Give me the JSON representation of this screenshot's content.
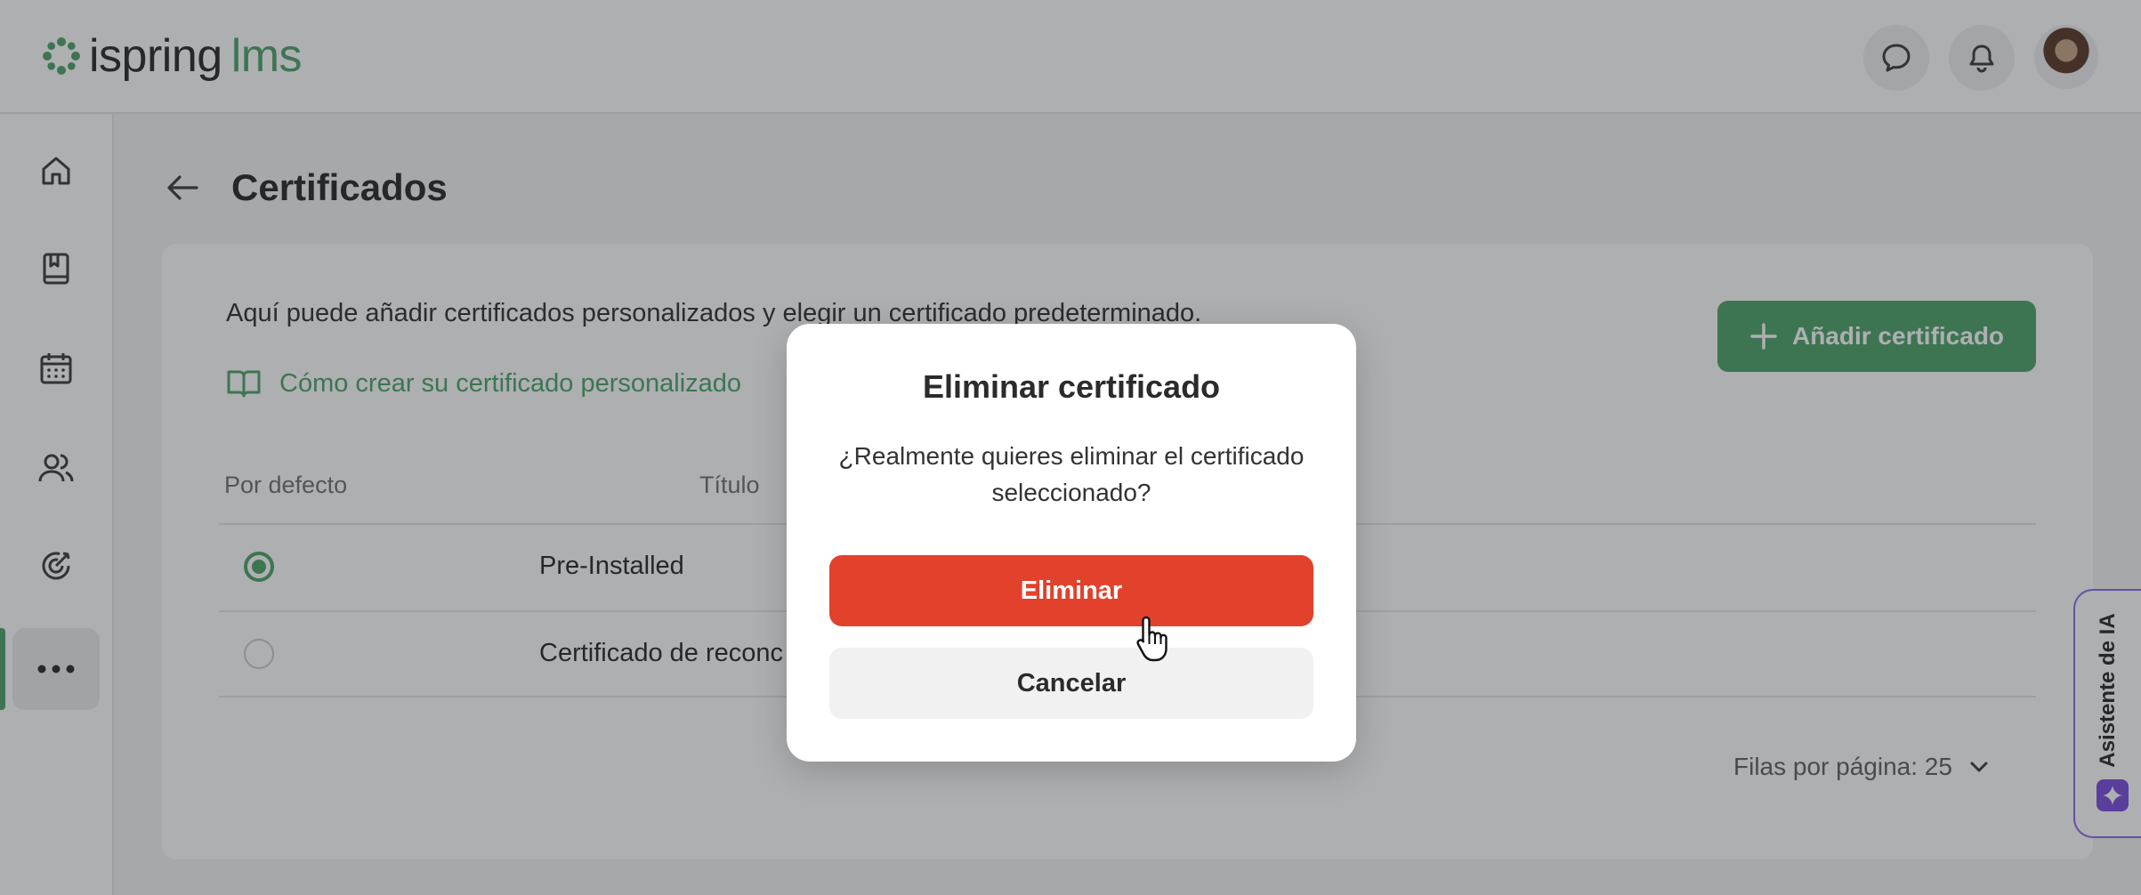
{
  "header": {
    "logo_primary": "ispring",
    "logo_secondary": "lms",
    "brand_color": "#4fa56e"
  },
  "sidebar": {
    "items": [
      {
        "name": "home",
        "icon": "home-icon",
        "active": false
      },
      {
        "name": "courses",
        "icon": "book-icon",
        "active": false
      },
      {
        "name": "calendar",
        "icon": "calendar-icon",
        "active": false
      },
      {
        "name": "users",
        "icon": "users-icon",
        "active": false
      },
      {
        "name": "goals",
        "icon": "target-icon",
        "active": false
      },
      {
        "name": "more",
        "icon": "more-horizontal-icon",
        "active": true
      }
    ]
  },
  "page": {
    "title": "Certificados"
  },
  "card": {
    "intro": "Aquí puede añadir certificados personalizados y elegir un certificado predeterminado.",
    "help_link": "Cómo crear su certificado personalizado",
    "add_button": "Añadir certificado"
  },
  "table": {
    "columns": [
      "Por defecto",
      "Título"
    ],
    "rows": [
      {
        "default": true,
        "title": "Pre-Installed"
      },
      {
        "default": false,
        "title": "Certificado de reconc"
      }
    ]
  },
  "pagination": {
    "rows_per_page": "Filas por página: 25"
  },
  "ai_assistant": {
    "label": "Asistente de IA",
    "accent": "#7b4fe0"
  },
  "modal": {
    "title": "Eliminar certificado",
    "message": "¿Realmente quieres eliminar el certificado seleccionado?",
    "confirm_label": "Eliminar",
    "cancel_label": "Cancelar",
    "confirm_color": "#e2412c"
  }
}
